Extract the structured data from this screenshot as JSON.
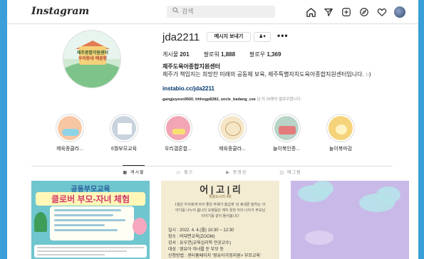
{
  "header": {
    "logo": "Instagram",
    "search_placeholder": "검색"
  },
  "nav_icons": [
    "home-icon",
    "direct-icon",
    "new-post-icon",
    "explore-icon",
    "activity-heart-icon",
    "profile-avatar-icon"
  ],
  "profile": {
    "username": "jda2211",
    "message_button": "메시지 보내기",
    "follow_button": "♟▾",
    "more": "•••",
    "stats": {
      "posts_label": "게시물",
      "posts": "201",
      "followers_label": "팔로워",
      "followers": "1,888",
      "following_label": "팔로우",
      "following": "1,369"
    },
    "full_name": "제주도육아종합지원센터",
    "bio": "제주가 책임지는 희망찬 미래의 공동체 보육, 제주특별자치도육아종합지원센터입니다. :-)",
    "link": "instabio.cc/jda2211",
    "followed_by_names": "gangjuyeon9560, hhhogp8282, uncle_badang_cee",
    "followed_by_suffix": "님 외 39명이 팔로우합니다",
    "picture_text_1": "제주종합지원센터",
    "picture_text_2": "우리동네 예꼼함"
  },
  "highlights": [
    {
      "label": "제육종클라...",
      "color": "#f7c7a3"
    },
    {
      "label": "6월부모교육",
      "color": "#c8d3de"
    },
    {
      "label": "우리결혼합...",
      "color": "#f2a6b5"
    },
    {
      "label": "제육종클라...",
      "color": "#f4e6c7"
    },
    {
      "label": "놀이북인증...",
      "color": "#b8d4c7"
    },
    {
      "label": "놀이북마감",
      "color": "#f5d37a"
    }
  ],
  "tabs": {
    "posts": "게시물",
    "reels": "릴스",
    "videos": "동영상",
    "tagged": "태그됨"
  },
  "posts": {
    "post1_title": "공동부모교육",
    "post1_subtitle": "클로버 부모-자녀 체험",
    "post2_title": "어 | 고 | 리",
    "post2_tag": "힐링오시리 4회",
    "post2_text": "1월은 우리에게 아이 좋은 주제가 흥겁게 '내 휴대폰 말하는' 이야기를 나누어 봅니다 오랫동안 깨지 못한 아이 나아가 부모님 이야기를 같이 들어봅니다",
    "post2_date": "일시 : 2022. 4. 4.(월) 10:30 ~ 12:30",
    "post2_place": "장소 : 비대면교육(ZOOM)",
    "post2_host": "강사 : 유우연(교육심리학 전공교수)",
    "post2_target": "대상 : 영유아 자녀를 둔 부모 등",
    "post2_apply": "신청방법 : 센터홈페이지 '영유아가정지원> 부모교육'"
  }
}
